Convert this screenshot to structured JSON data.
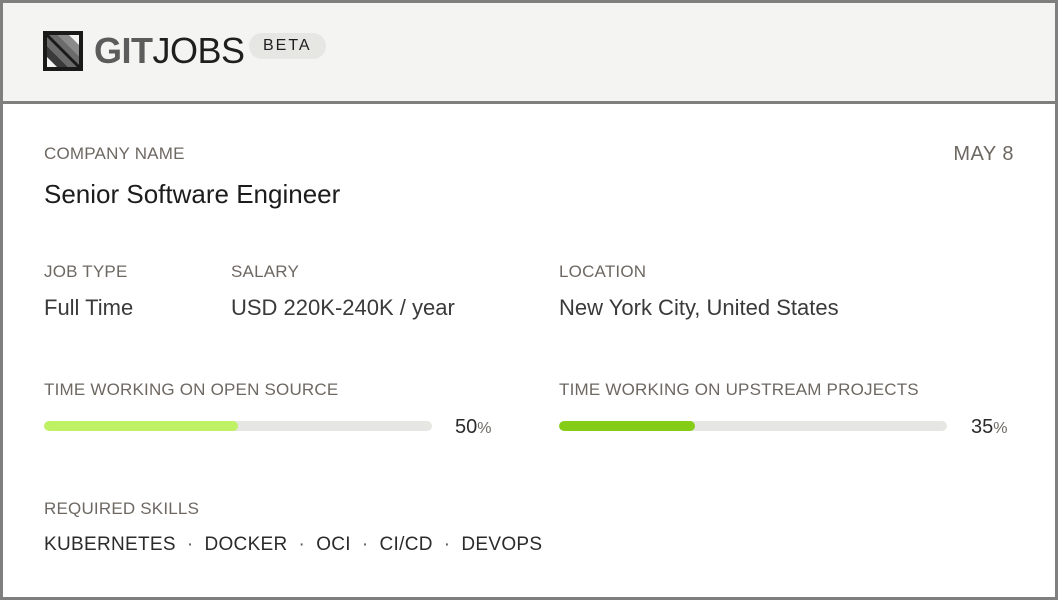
{
  "brand": {
    "git": "GIT",
    "jobs": "JOBS",
    "badge": "BETA",
    "logo_icon": "gitjobs-logo-icon"
  },
  "job": {
    "company_label": "COMPANY NAME",
    "title": "Senior Software Engineer",
    "date": "MAY 8",
    "job_type_label": "JOB TYPE",
    "job_type": "Full Time",
    "salary_label": "SALARY",
    "salary": "USD 220K-240K / year",
    "location_label": "LOCATION",
    "location": "New York City, United States"
  },
  "metrics": {
    "open_source": {
      "label": "TIME WORKING ON OPEN SOURCE",
      "value": "50",
      "unit": "%",
      "fraction": 0.5,
      "color": "#bef264"
    },
    "upstream": {
      "label": "TIME WORKING ON UPSTREAM PROJECTS",
      "value": "35",
      "unit": "%",
      "fraction": 0.35,
      "color": "#84cc16"
    }
  },
  "skills": {
    "label": "REQUIRED SKILLS",
    "items": [
      "KUBERNETES",
      "DOCKER",
      "OCI",
      "CI/CD",
      "DEVOPS"
    ],
    "separator": "·"
  },
  "colors": {
    "border": "#7f7f7f",
    "header_bg": "#f4f4f2",
    "track": "#e6e6e3"
  }
}
